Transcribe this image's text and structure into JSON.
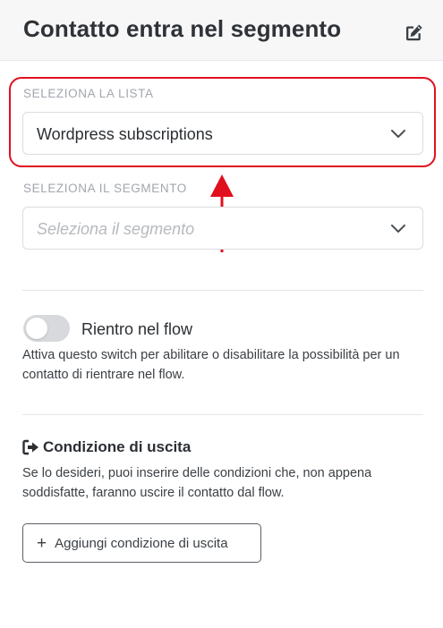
{
  "header": {
    "title": "Contatto entra nel segmento",
    "edit_icon": "edit-icon"
  },
  "list_field": {
    "label": "SELEZIONA LA LISTA",
    "value": "Wordpress subscriptions"
  },
  "segment_field": {
    "label": "SELEZIONA IL SEGMENTO",
    "placeholder": "Seleziona il segmento"
  },
  "reentry": {
    "label": "Rientro nel flow",
    "enabled": false,
    "help": "Attiva questo switch per abilitare o disabilitare la possibilità per un contatto di rientrare nel flow."
  },
  "exit_condition": {
    "title": "Condizione di uscita",
    "icon": "sign-out-icon",
    "help": "Se lo desideri, puoi inserire delle condizioni che, non appena soddisfatte, faranno uscire il contatto dal flow.",
    "button_label": "Aggiungi condizione di uscita"
  },
  "colors": {
    "annotation": "#e0101f",
    "text": "#2b2f33",
    "muted": "#a2a6ad"
  }
}
